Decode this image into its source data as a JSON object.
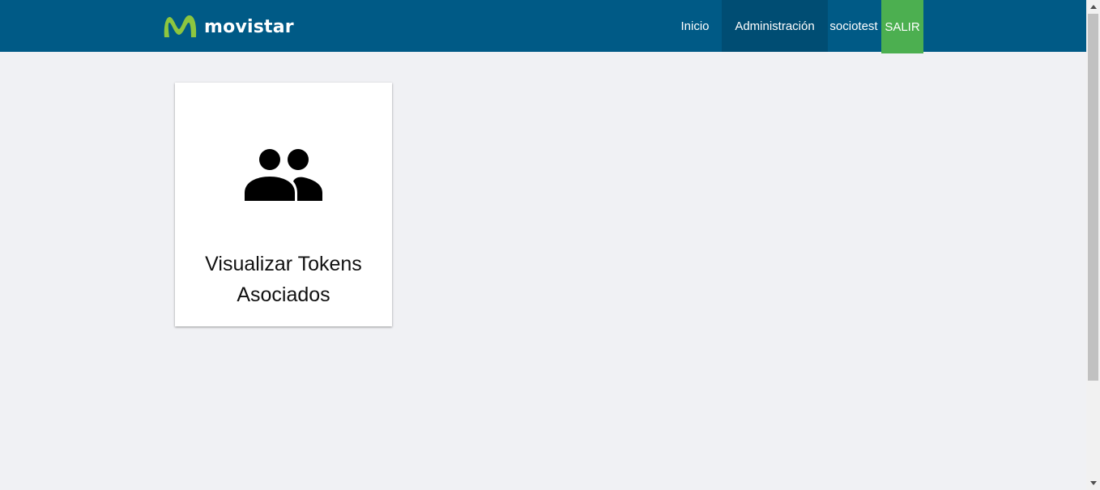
{
  "brand": {
    "logo_text": "movistar",
    "colors": {
      "header": "#005a86",
      "active_nav": "#004d73",
      "logout": "#4caf50",
      "logo_green": "#8dc63f"
    }
  },
  "nav": {
    "inicio": "Inicio",
    "administracion": "Administración",
    "user": "sociotest",
    "logout": "SALIR"
  },
  "cards": [
    {
      "icon": "people-icon",
      "title": "Visualizar Tokens Asociados"
    }
  ]
}
